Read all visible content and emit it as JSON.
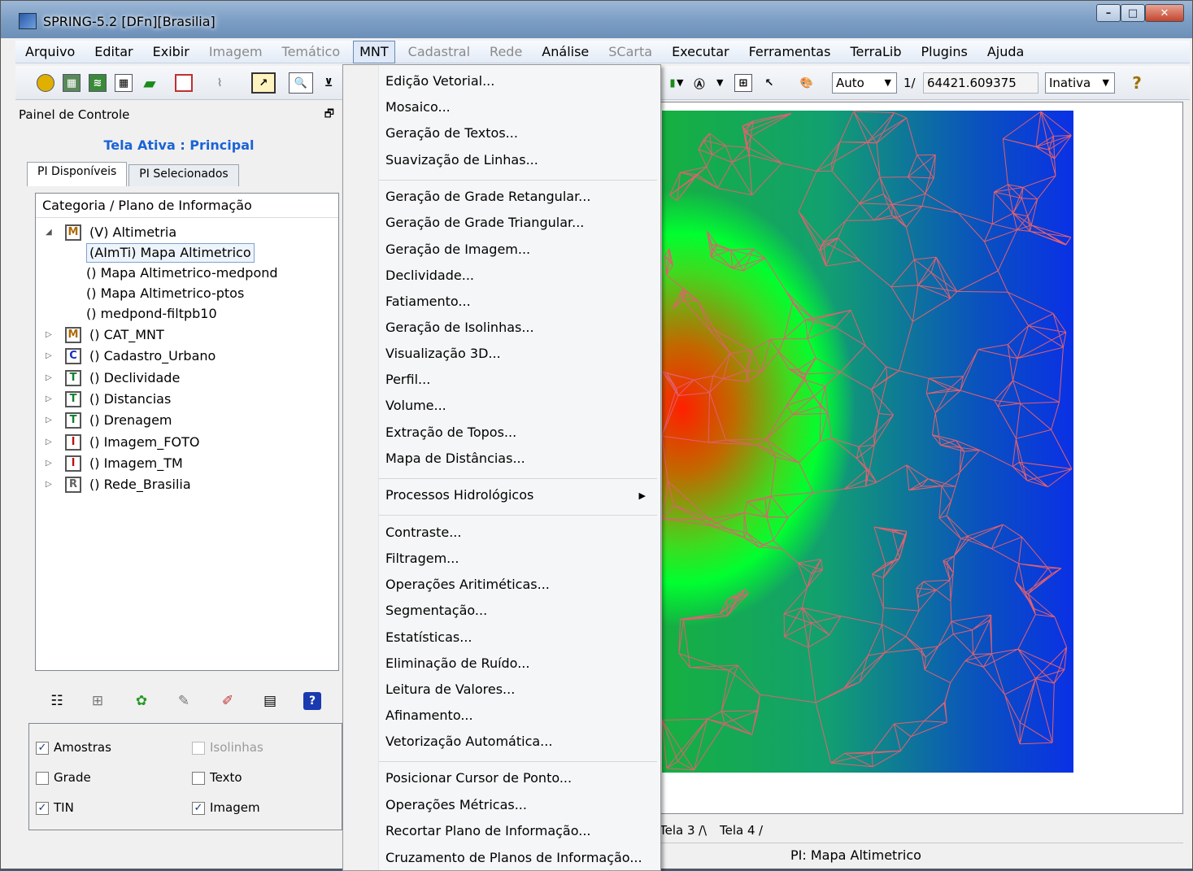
{
  "window": {
    "title": "SPRING-5.2 [DFn][Brasilia]"
  },
  "menubar": [
    {
      "label": "Arquivo",
      "enabled": true
    },
    {
      "label": "Editar",
      "enabled": true
    },
    {
      "label": "Exibir",
      "enabled": true
    },
    {
      "label": "Imagem",
      "enabled": false
    },
    {
      "label": "Temático",
      "enabled": false
    },
    {
      "label": "MNT",
      "enabled": true,
      "active": true
    },
    {
      "label": "Cadastral",
      "enabled": false
    },
    {
      "label": "Rede",
      "enabled": false
    },
    {
      "label": "Análise",
      "enabled": true
    },
    {
      "label": "SCarta",
      "enabled": false
    },
    {
      "label": "Executar",
      "enabled": true
    },
    {
      "label": "Ferramentas",
      "enabled": true
    },
    {
      "label": "TerraLib",
      "enabled": true
    },
    {
      "label": "Plugins",
      "enabled": true
    },
    {
      "label": "Ajuda",
      "enabled": true
    }
  ],
  "toolbar": {
    "zoom_mode": "Auto",
    "scale_prefix": "1/",
    "scale_value": "64421.609375",
    "state": "Inativa"
  },
  "panel": {
    "title": "Painel de Controle",
    "active_screen": "Tela Ativa : Principal",
    "tabs": [
      "PI Disponíveis",
      "PI Selecionados"
    ],
    "tree_header": "Categoria / Plano de Informação",
    "categories": [
      {
        "icon": "M",
        "label": "(V) Altimetria",
        "expanded": true,
        "color": "#b06a00"
      },
      {
        "icon": "M",
        "label": "() CAT_MNT",
        "color": "#b06a00"
      },
      {
        "icon": "C",
        "label": "() Cadastro_Urbano",
        "color": "#1030c0"
      },
      {
        "icon": "T",
        "label": "() Declividade",
        "color": "#108030"
      },
      {
        "icon": "T",
        "label": "() Distancias",
        "color": "#108030"
      },
      {
        "icon": "T",
        "label": "() Drenagem",
        "color": "#108030"
      },
      {
        "icon": "I",
        "label": "() Imagem_FOTO",
        "color": "#c01010"
      },
      {
        "icon": "I",
        "label": "() Imagem_TM",
        "color": "#c01010"
      },
      {
        "icon": "R",
        "label": "() Rede_Brasilia",
        "color": "#606060"
      }
    ],
    "children": [
      "(AImTi) Mapa Altimetrico",
      "() Mapa Altimetrico-medpond",
      "() Mapa Altimetrico-ptos",
      "() medpond-filtpb10"
    ],
    "checkboxes": [
      {
        "label": "Amostras",
        "checked": true,
        "enabled": true
      },
      {
        "label": "Isolinhas",
        "checked": false,
        "enabled": false
      },
      {
        "label": "Grade",
        "checked": false,
        "enabled": true
      },
      {
        "label": "Texto",
        "checked": false,
        "enabled": true
      },
      {
        "label": "TIN",
        "checked": true,
        "enabled": true
      },
      {
        "label": "Imagem",
        "checked": true,
        "enabled": true
      }
    ]
  },
  "mnt_menu": [
    "Edição Vetorial...",
    "Mosaico...",
    "Geração de Textos...",
    "Suavização de Linhas...",
    "Geração de Grade Retangular...",
    "Geração de Grade Triangular...",
    "Geração de Imagem...",
    "Declividade...",
    "Fatiamento...",
    "Geração de Isolinhas...",
    "Visualização 3D...",
    "Perfil...",
    "Volume...",
    "Extração de Topos...",
    "Mapa de Distâncias...",
    "Processos Hidrológicos",
    "Contraste...",
    "Filtragem...",
    "Operações Aritiméticas...",
    "Segmentação...",
    "Estatísticas...",
    "Eliminação de Ruído...",
    "Leitura de Valores...",
    "Afinamento...",
    "Vetorização Automática...",
    "Posicionar Cursor de Ponto...",
    "Operações Métricas...",
    "Recortar Plano de Informação...",
    "Cruzamento de Planos de Informação..."
  ],
  "screen_tabs": [
    "Tela 3",
    "Tela 4"
  ],
  "status": {
    "pi": "PI: Mapa Altimetrico"
  },
  "colors": {
    "accent": "#1a63d6",
    "tin_lines": "#e06070",
    "low": "#0a30e6",
    "mid": "#00ff30",
    "high": "#ff2000"
  }
}
